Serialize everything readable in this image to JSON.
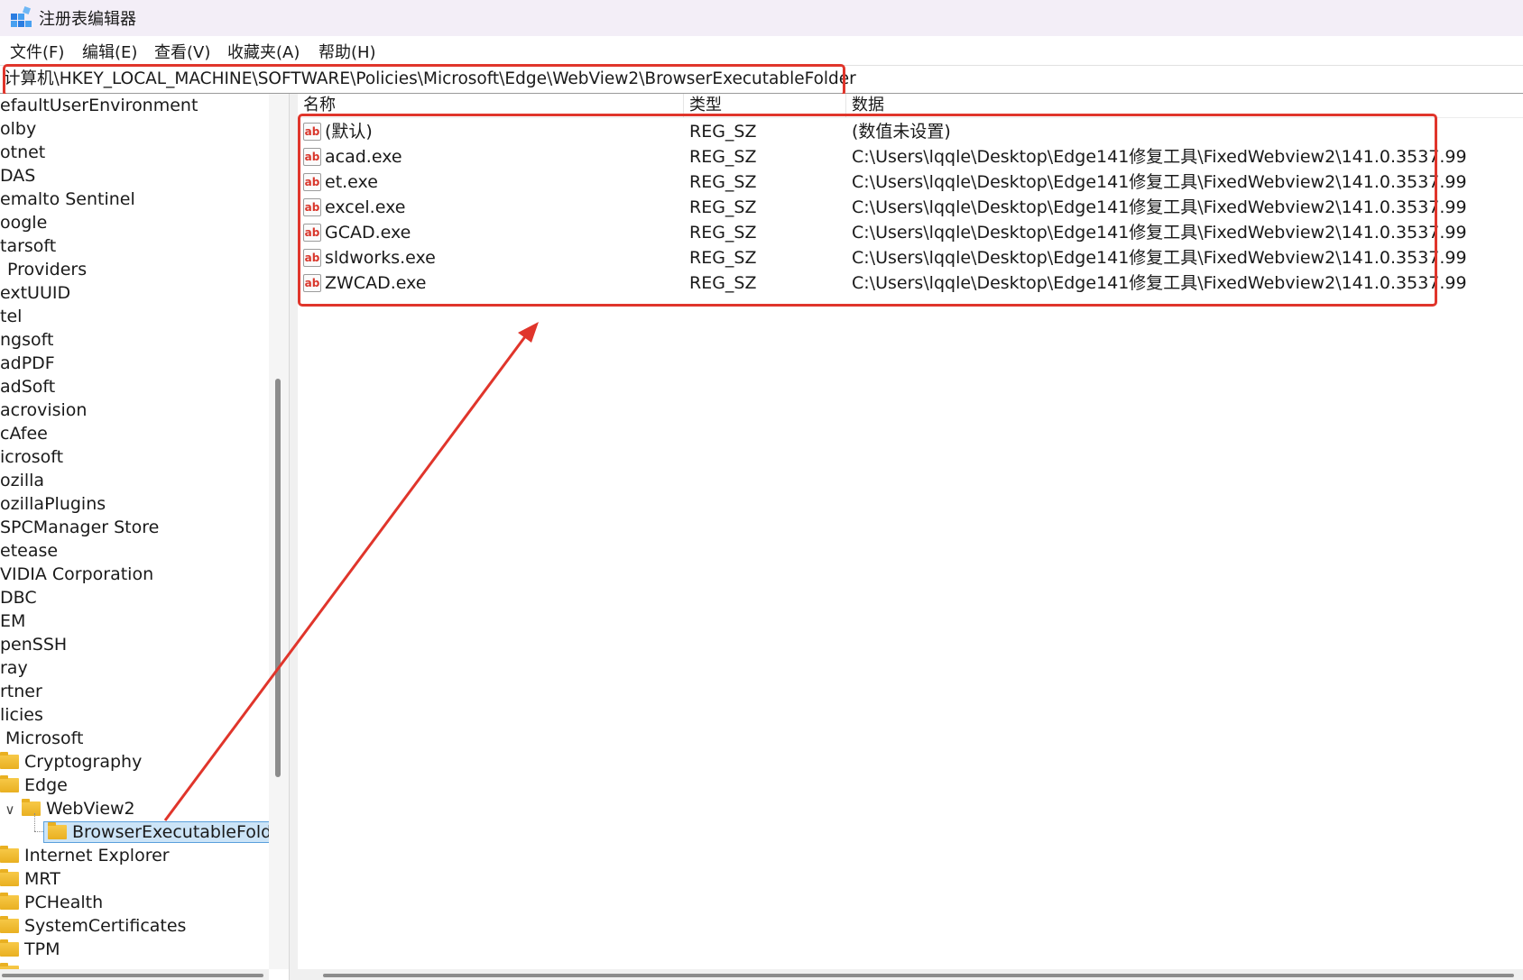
{
  "window": {
    "title": "注册表编辑器",
    "icon": "registry-editor-icon"
  },
  "menu": [
    {
      "label": "文件(F)"
    },
    {
      "label": "编辑(E)"
    },
    {
      "label": "查看(V)"
    },
    {
      "label": "收藏夹(A)"
    },
    {
      "label": "帮助(H)"
    }
  ],
  "address": {
    "path": "计算机\\HKEY_LOCAL_MACHINE\\SOFTWARE\\Policies\\Microsoft\\Edge\\WebView2\\BrowserExecutableFolder"
  },
  "tree": {
    "items": [
      {
        "label": "efaultUserEnvironment"
      },
      {
        "label": "olby"
      },
      {
        "label": "otnet"
      },
      {
        "label": "DAS"
      },
      {
        "label": "emalto Sentinel"
      },
      {
        "label": "oogle"
      },
      {
        "label": "tarsoft"
      },
      {
        "label": "Providers"
      },
      {
        "label": "extUUID"
      },
      {
        "label": "tel"
      },
      {
        "label": "ngsoft"
      },
      {
        "label": "adPDF"
      },
      {
        "label": "adSoft"
      },
      {
        "label": "acrovision"
      },
      {
        "label": "cAfee"
      },
      {
        "label": "icrosoft"
      },
      {
        "label": "ozilla"
      },
      {
        "label": "ozillaPlugins"
      },
      {
        "label": "SPCManager Store"
      },
      {
        "label": "etease"
      },
      {
        "label": "VIDIA Corporation"
      },
      {
        "label": "DBC"
      },
      {
        "label": "EM"
      },
      {
        "label": "penSSH"
      },
      {
        "label": "ray"
      },
      {
        "label": "rtner"
      },
      {
        "label": "licies"
      },
      {
        "label": "Microsoft"
      },
      {
        "label": "Cryptography"
      },
      {
        "label": "Edge"
      },
      {
        "label": "WebView2",
        "expander": "∨"
      },
      {
        "label": "BrowserExecutableFolder",
        "selected": true
      },
      {
        "label": "Internet Explorer"
      },
      {
        "label": "MRT"
      },
      {
        "label": "PCHealth"
      },
      {
        "label": "SystemCertificates"
      },
      {
        "label": "TPM"
      }
    ]
  },
  "values": {
    "headers": {
      "name": "名称",
      "type": "类型",
      "data": "数据"
    },
    "rows": [
      {
        "name": "(默认)",
        "type": "REG_SZ",
        "data": "(数值未设置)",
        "icon": "string-value-icon"
      },
      {
        "name": "acad.exe",
        "type": "REG_SZ",
        "data": "C:\\Users\\lqqle\\Desktop\\Edge141修复工具\\FixedWebview2\\141.0.3537.99",
        "icon": "string-value-icon"
      },
      {
        "name": "et.exe",
        "type": "REG_SZ",
        "data": "C:\\Users\\lqqle\\Desktop\\Edge141修复工具\\FixedWebview2\\141.0.3537.99",
        "icon": "string-value-icon"
      },
      {
        "name": "excel.exe",
        "type": "REG_SZ",
        "data": "C:\\Users\\lqqle\\Desktop\\Edge141修复工具\\FixedWebview2\\141.0.3537.99",
        "icon": "string-value-icon"
      },
      {
        "name": "GCAD.exe",
        "type": "REG_SZ",
        "data": "C:\\Users\\lqqle\\Desktop\\Edge141修复工具\\FixedWebview2\\141.0.3537.99",
        "icon": "string-value-icon"
      },
      {
        "name": "sldworks.exe",
        "type": "REG_SZ",
        "data": "C:\\Users\\lqqle\\Desktop\\Edge141修复工具\\FixedWebview2\\141.0.3537.99",
        "icon": "string-value-icon"
      },
      {
        "name": "ZWCAD.exe",
        "type": "REG_SZ",
        "data": "C:\\Users\\lqqle\\Desktop\\Edge141修复工具\\FixedWebview2\\141.0.3537.99",
        "icon": "string-value-icon"
      }
    ],
    "icon_text": "ab"
  },
  "colors": {
    "annotation_red": "#e0352b",
    "selection_bg": "#cce4f7",
    "titlebar_bg": "#f3eef7",
    "folder_yellow": "#f7c948"
  }
}
